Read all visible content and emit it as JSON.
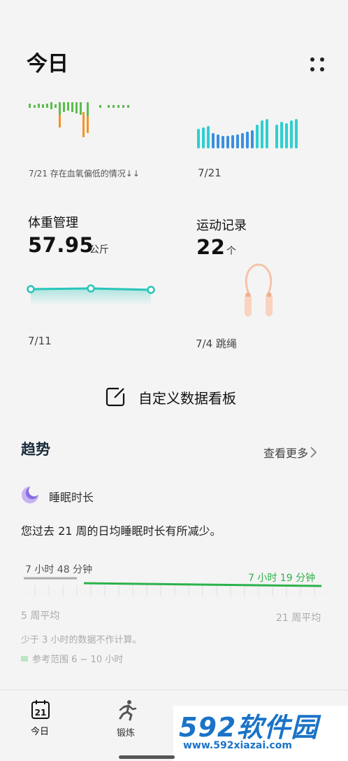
{
  "header": {
    "title": "今日"
  },
  "spo2": {
    "caption": "7/21 存在血氧偏低的情况↓↓"
  },
  "heart_rate": {
    "caption": "7/21"
  },
  "weight": {
    "title": "体重管理",
    "value": "57.95",
    "unit": "公斤",
    "caption": "7/11"
  },
  "activity": {
    "title": "运动记录",
    "value": "22",
    "unit": "个",
    "caption": "7/4 跳绳"
  },
  "customize": {
    "label": "自定义数据看板"
  },
  "trends": {
    "title": "趋势",
    "see_more": "查看更多",
    "sleep": {
      "label": "睡眠时长",
      "description": "您过去 21 周的日均睡眠时长有所减少。",
      "avg_5w_value": "7 小时 48 分钟",
      "avg_21w_value": "7 小时 19 分钟",
      "avg_5w_label": "5 周平均",
      "avg_21w_label": "21 周平均",
      "note": "少于 3 小时的数据不作计算。",
      "reference": "参考范围 6 ~ 10 小时"
    }
  },
  "nav": {
    "today_date": "21",
    "today_label": "今日",
    "exercise_label": "锻炼"
  },
  "watermark": {
    "main": "592软件园",
    "sub": "www.592xiazai.com"
  },
  "colors": {
    "spo2_green": "#5cbd4e",
    "spo2_orange": "#f39323",
    "heart_teal": "#2ecfd2",
    "heart_blue": "#3a8fe0",
    "weight_line": "#27c6b8",
    "sleep_green": "#2db24a",
    "watermark_blue": "#1a73c8"
  }
}
